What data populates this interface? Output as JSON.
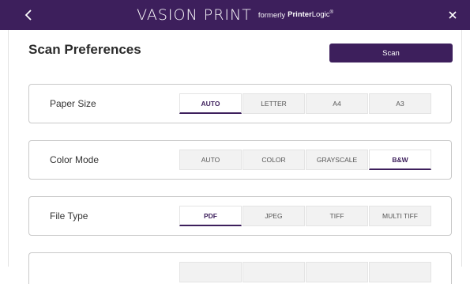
{
  "header": {
    "brand_main": "VASION PRINT",
    "formerly": "formerly",
    "old_name_bold": "Printer",
    "old_name_regular": "Logic",
    "registered": "®",
    "back_icon": "chevron-left-icon",
    "close_icon": "close-icon",
    "bg_color": "#3d1f5c"
  },
  "page": {
    "title": "Scan Preferences",
    "scan_label": "Scan"
  },
  "settings": [
    {
      "label": "Paper Size",
      "options": [
        "AUTO",
        "LETTER",
        "A4",
        "A3"
      ],
      "selected": "AUTO"
    },
    {
      "label": "Color Mode",
      "options": [
        "AUTO",
        "COLOR",
        "GRAYSCALE",
        "B&W"
      ],
      "selected": "B&W"
    },
    {
      "label": "File Type",
      "options": [
        "PDF",
        "JPEG",
        "TIFF",
        "MULTI TIFF"
      ],
      "selected": "PDF"
    }
  ],
  "colors": {
    "accent": "#3d1f5c"
  }
}
